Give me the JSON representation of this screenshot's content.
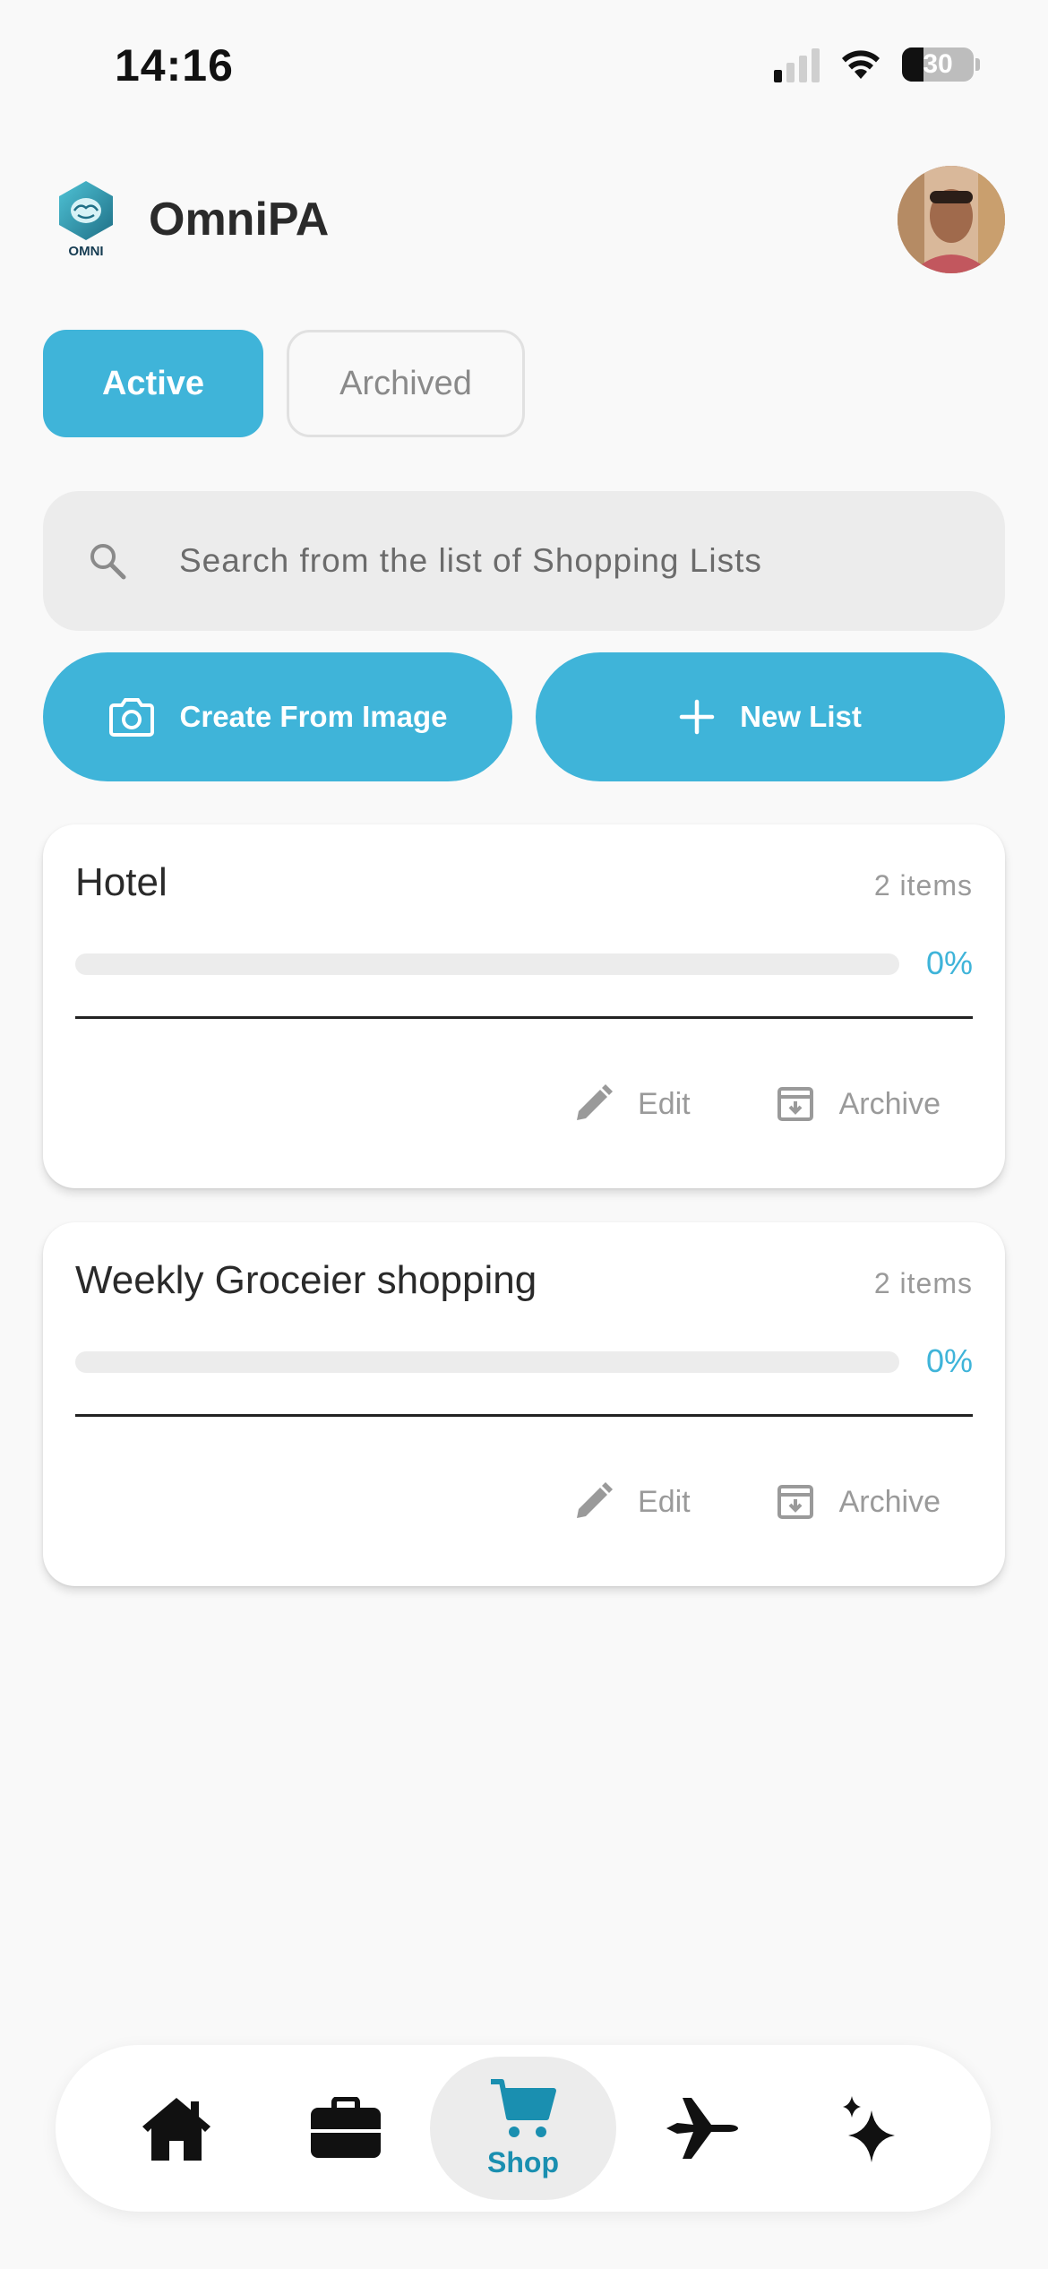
{
  "status_bar": {
    "time": "14:16",
    "battery": "30"
  },
  "header": {
    "app_title": "OmniPA",
    "logo_text": "OMNI"
  },
  "tabs": [
    {
      "label": "Active",
      "selected": true
    },
    {
      "label": "Archived",
      "selected": false
    }
  ],
  "search": {
    "placeholder": "Search from the list of Shopping Lists",
    "value": ""
  },
  "actions": {
    "create_from_image": "Create From Image",
    "new_list": "New List"
  },
  "lists": [
    {
      "title": "Hotel",
      "count": "2 items",
      "progress": 0,
      "progress_label": "0%",
      "edit_label": "Edit",
      "archive_label": "Archive"
    },
    {
      "title": "Weekly Groceier shopping",
      "count": "2 items",
      "progress": 0,
      "progress_label": "0%",
      "edit_label": "Edit",
      "archive_label": "Archive"
    }
  ],
  "bottom_nav": {
    "items": [
      {
        "icon": "home-icon",
        "label": ""
      },
      {
        "icon": "briefcase-icon",
        "label": ""
      },
      {
        "icon": "cart-icon",
        "label": "Shop",
        "active": true
      },
      {
        "icon": "airplane-icon",
        "label": ""
      },
      {
        "icon": "sparkle-icon",
        "label": ""
      }
    ]
  },
  "colors": {
    "accent": "#3fb4d9",
    "nav_active": "#1a8fb0",
    "background": "#f9f9f9"
  }
}
